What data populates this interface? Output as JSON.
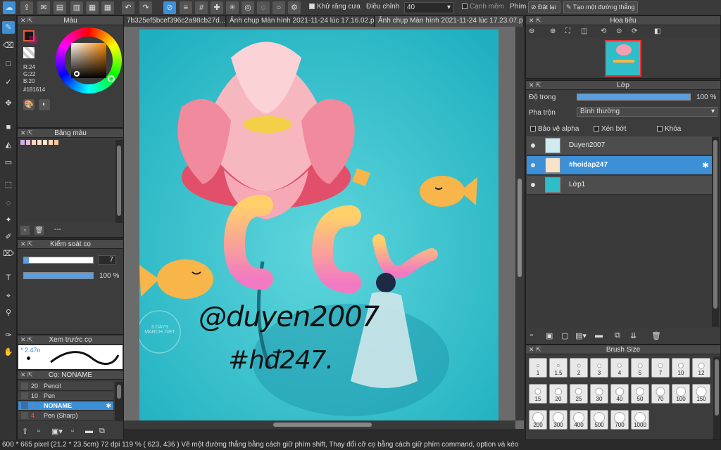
{
  "toolbar": {
    "antialias_label": "Khử răng cưa",
    "adjust_label": "Điều chỉnh",
    "adjust_value": "40",
    "soft_edge_label": "Cạnh mềm",
    "keys_label": "Phím",
    "reset_label": "Đặt lại",
    "straight_line_label": "Tạo một đường thẳng"
  },
  "tabs": [
    "7b325ef5bcef396c2a98cb27d...",
    "Ảnh chụp Màn hình 2021-11-24 lúc 17.16.02.pn...",
    "Ảnh chụp Màn hình 2021-11-24 lúc 17.23.07.pn..."
  ],
  "color_panel": {
    "title": "Màu",
    "r": "R:24",
    "g": "G:22",
    "b": "B:20",
    "hex": "#181614"
  },
  "palette_panel": {
    "title": "Bảng màu",
    "footer": "---"
  },
  "brush_control": {
    "title": "Kiểm soát cọ",
    "size": "7",
    "opacity": "100 %",
    "opacity_fraction": 1.0,
    "size_fraction": 0.07
  },
  "brush_preview": {
    "title": "Xem trước cọ",
    "size_label": "2.47n"
  },
  "brush_list": {
    "title": "Cọ: NONAME",
    "items": [
      {
        "size": "20",
        "name": "Pencil"
      },
      {
        "size": "10",
        "name": "Pen"
      },
      {
        "size": "7",
        "name": "NONAME"
      },
      {
        "size": "4",
        "name": "Pen (Sharp)"
      }
    ]
  },
  "navigator": {
    "title": "Hoa tiêu"
  },
  "layer_panel": {
    "title": "Lớp",
    "opacity_label": "Độ trong",
    "opacity_value": "100 %",
    "opacity_fraction": 1.0,
    "blend_label": "Pha trộn",
    "blend_value": "Bình thường",
    "protect_alpha": "Bảo vệ alpha",
    "clipping": "Xén bớt",
    "lock": "Khóa",
    "layers": [
      "Duyen2007",
      "#hoidap247",
      "Lớp1"
    ]
  },
  "brush_size_panel": {
    "title": "Brush Size",
    "sizes": [
      "1",
      "1.5",
      "2",
      "3",
      "4",
      "5",
      "7",
      "10",
      "12",
      "15",
      "20",
      "25",
      "30",
      "40",
      "50",
      "70",
      "100",
      "150",
      "200",
      "300",
      "400",
      "500",
      "700",
      "1000"
    ]
  },
  "canvas": {
    "handwriting_1": "@duyen2007",
    "handwriting_2": "#hđ247.",
    "watermark": "3 DAYS MARCH .NET"
  },
  "status": "600 * 665 pixel   (21.2 * 23.5cm)   72 dpi   119 %   ( 623, 436 )   Vẽ một đường thẳng bằng cách giữ phím shift, Thay đổi cỡ cọ bằng cách giữ phím command, option và kéo",
  "colors": {
    "accent": "#3d8fd6",
    "fg_color": "#181614",
    "canvas_bg": "#2fbec9"
  }
}
